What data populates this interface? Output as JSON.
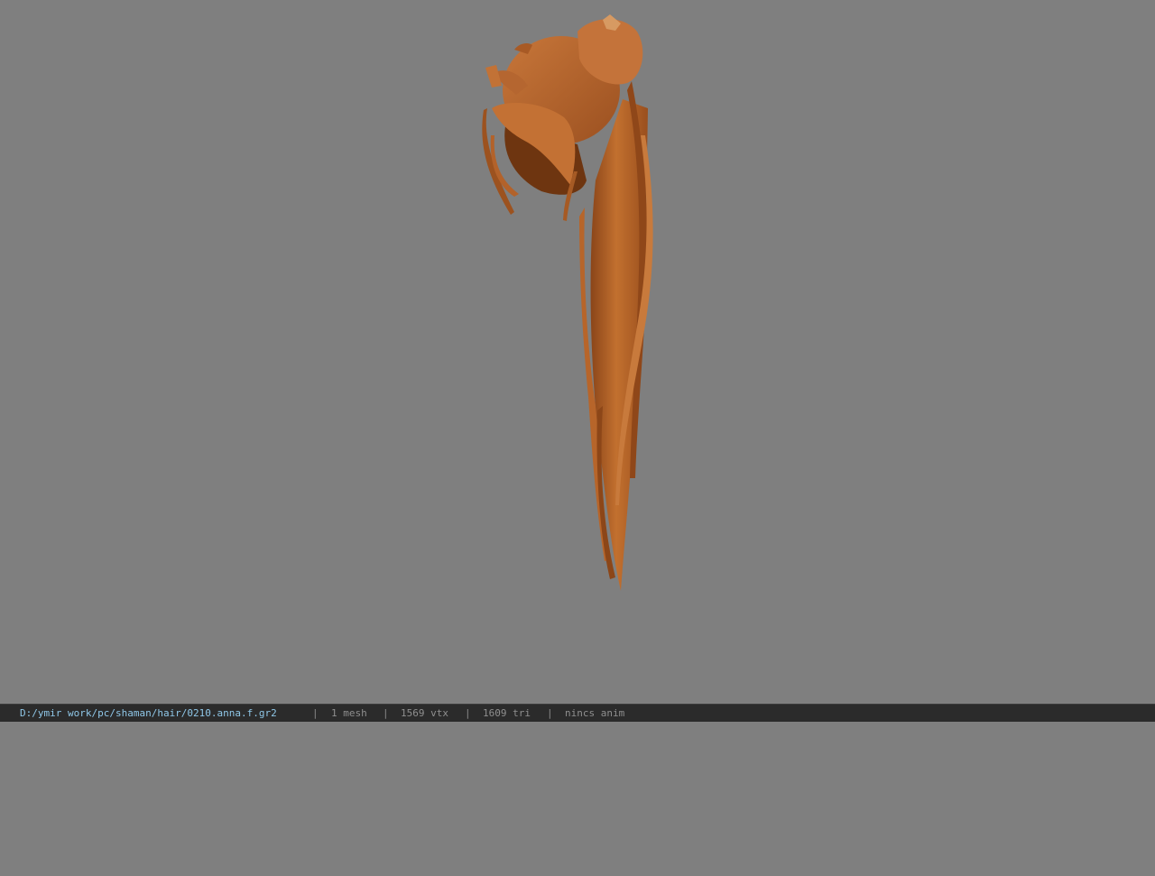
{
  "viewport": {
    "background_color": "#7f7f7f",
    "model_color": "#b8662e",
    "model_shadow_color": "#7a3d14"
  },
  "statusbar": {
    "file_path": "D:/ymir work/pc/shaman/hair/0210.anna.f.gr2",
    "separator": "|",
    "mesh_count": "1 mesh",
    "vertex_count": "1569 vtx",
    "triangle_count": "1609 tri",
    "anim_status": "nincs anim"
  }
}
